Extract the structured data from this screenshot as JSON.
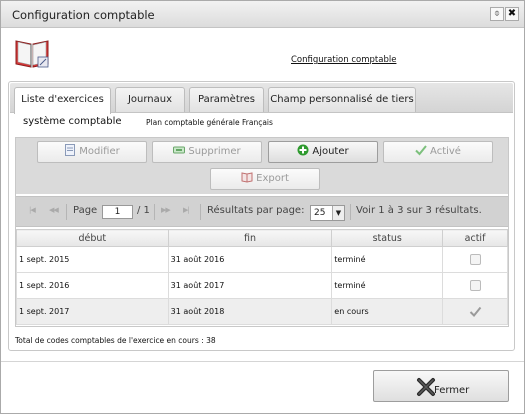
{
  "window": {
    "title": "Configuration comptable",
    "pin_glyph": "⌽",
    "close_glyph": "✖"
  },
  "header": {
    "icon": "accounting-book-icon",
    "link": "Configuration comptable"
  },
  "tabs": [
    {
      "label": "Liste d'exercices",
      "active": true
    },
    {
      "label": "Journaux",
      "active": false
    },
    {
      "label": "Paramètres",
      "active": false
    },
    {
      "label": "Champ personnalisé de tiers",
      "active": false
    }
  ],
  "system": {
    "label": "système comptable",
    "value": "Plan comptable générale Français"
  },
  "toolbar": {
    "modifier": "Modifier",
    "supprimer": "Supprimer",
    "ajouter": "Ajouter",
    "active": "Activé",
    "export": "Export"
  },
  "pager": {
    "page_label": "Page",
    "page_value": "1",
    "of_label": "/ 1",
    "per_page_label": "Résultats par page:",
    "per_page_value": "25",
    "summary": "Voir 1 à 3 sur 3 résultats."
  },
  "table": {
    "columns": [
      "début",
      "fin",
      "status",
      "actif"
    ],
    "rows": [
      {
        "debut": "1 sept. 2015",
        "fin": "31 août 2016",
        "status": "terminé",
        "actif": false
      },
      {
        "debut": "1 sept. 2016",
        "fin": "31 août 2017",
        "status": "terminé",
        "actif": false
      },
      {
        "debut": "1 sept. 2017",
        "fin": "31 août 2018",
        "status": "en cours",
        "actif": true
      }
    ]
  },
  "total": "Total de codes comptables de l'exercice en cours : 38",
  "footer": {
    "close": "Fermer"
  },
  "colors": {
    "toolbar_bg": "#dadada",
    "add_icon": "#2e9a2e",
    "close_icon_x": "#333333"
  }
}
